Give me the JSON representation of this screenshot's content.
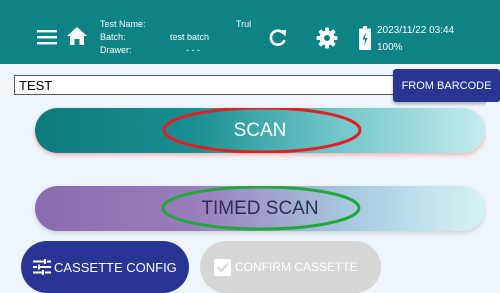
{
  "header": {
    "test_name_label": "Test Name:",
    "test_name_value": "Trul",
    "batch_label": "Batch:",
    "batch_value": "test batch",
    "drawer_label": "Drawer:",
    "drawer_value": "- - -",
    "datetime": "2023/11/22 03:44",
    "battery_percent": "100%"
  },
  "search": {
    "value": "TEST",
    "barcode_button_label": "FROM BARCODE"
  },
  "main": {
    "scan_label": "SCAN",
    "timed_scan_label": "TIMED SCAN"
  },
  "footer": {
    "cassette_config_label": "CASSETTE CONFIG",
    "confirm_cassette_label": "CONFIRM CASSETTE"
  },
  "colors": {
    "header_bg": "#0e8386",
    "primary_button": "#283593",
    "disabled_button": "#d6d6d6",
    "scan_highlight": "#e02020",
    "timed_scan_highlight": "#22a83a"
  },
  "icons": [
    "menu-icon",
    "home-icon",
    "refresh-icon",
    "gear-icon",
    "battery-icon",
    "tune-icon",
    "checkbox-icon"
  ]
}
